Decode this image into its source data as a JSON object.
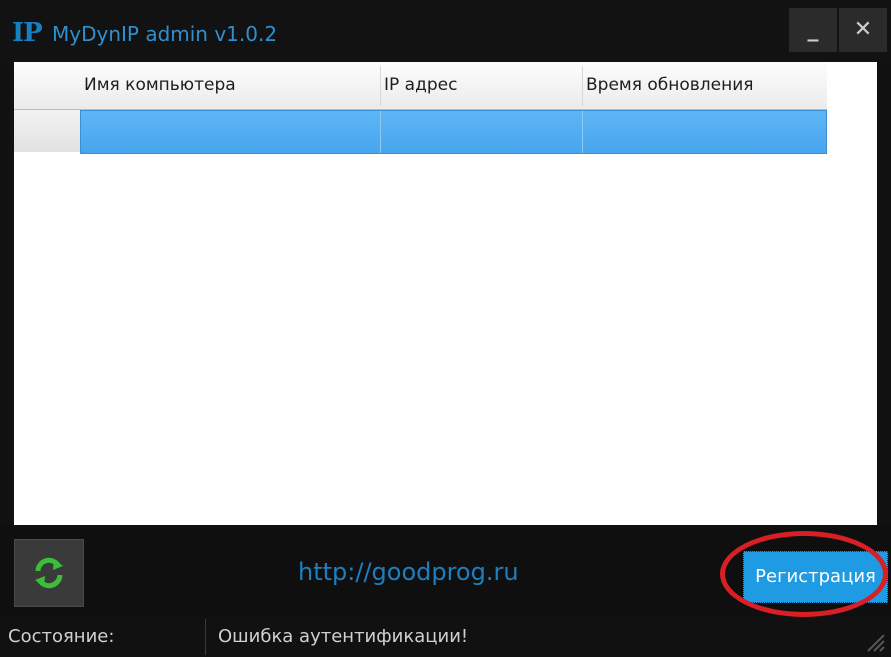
{
  "window": {
    "logo": "IP",
    "title": "MyDynIP admin v1.0.2",
    "minimize_label": "_",
    "close_label": "✕"
  },
  "grid": {
    "columns": [
      "Имя компьютера",
      "IP адрес",
      "Время обновления"
    ],
    "rows": [
      {
        "computer": "",
        "ip": "",
        "updated": "",
        "selected": true
      }
    ]
  },
  "bottom": {
    "refresh_icon": "refresh-icon",
    "link_text": "http://goodprog.ru",
    "register_label": "Регистрация"
  },
  "status": {
    "label": "Состояние:",
    "value": "Ошибка аутентификации!"
  },
  "colors": {
    "accent": "#1e9be3",
    "selection": "#4ea9ef",
    "highlight": "#d81f26"
  }
}
